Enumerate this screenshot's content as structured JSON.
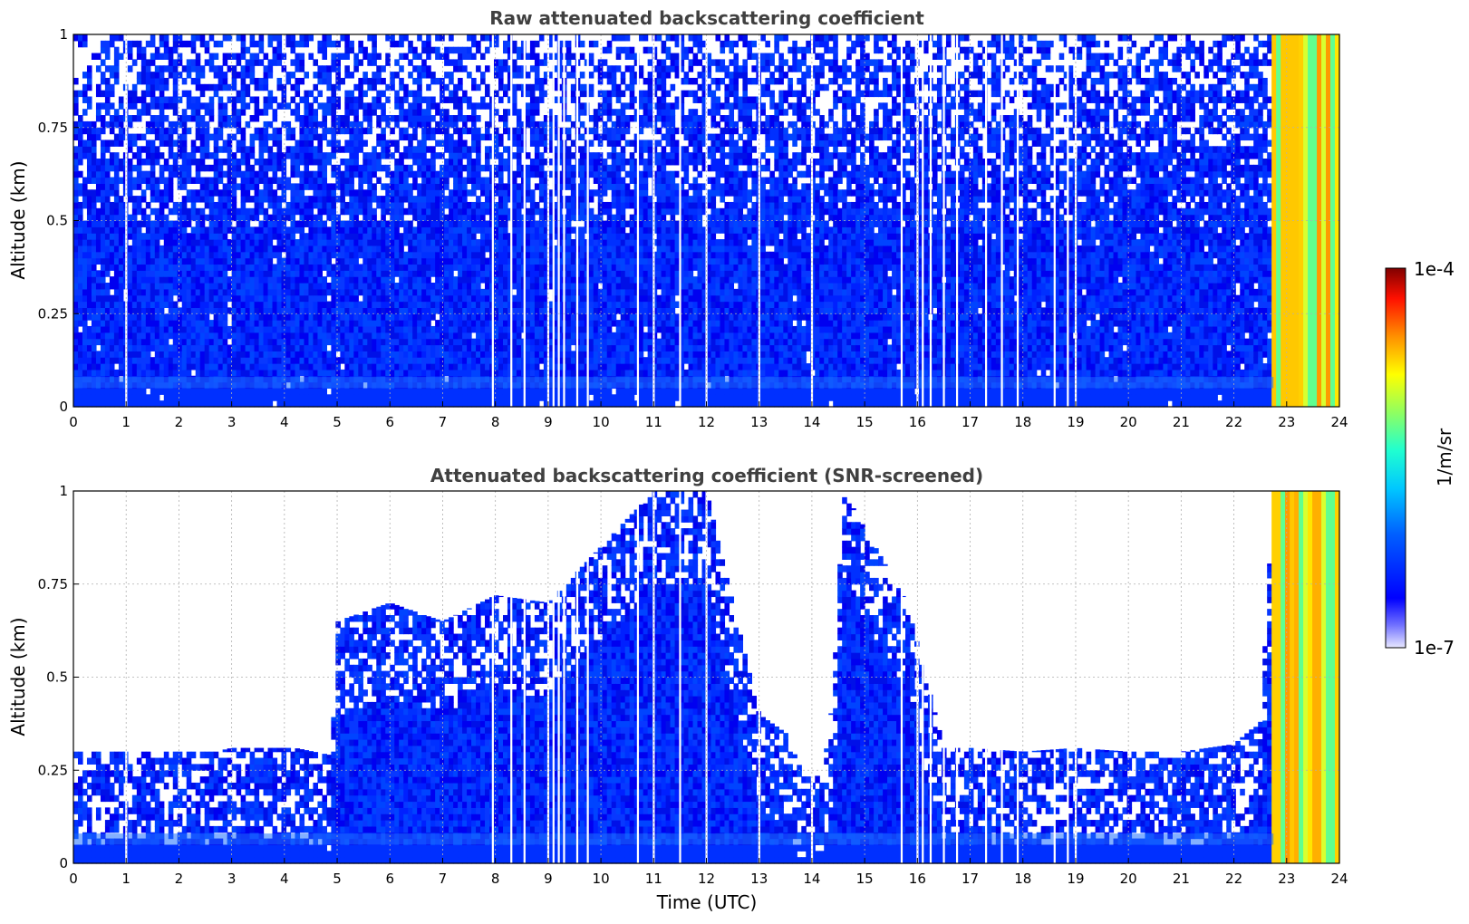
{
  "chart_data": [
    {
      "type": "heatmap",
      "title": "Raw attenuated backscattering coefficient",
      "xlabel": "",
      "ylabel": "Altitude (km)",
      "xlim": [
        0,
        24
      ],
      "ylim": [
        0,
        1
      ],
      "xticks": [
        "0",
        "1",
        "2",
        "3",
        "4",
        "5",
        "6",
        "7",
        "8",
        "9",
        "10",
        "11",
        "12",
        "13",
        "14",
        "15",
        "16",
        "17",
        "18",
        "19",
        "20",
        "21",
        "22",
        "23",
        "24"
      ],
      "yticks": [
        "0",
        "0.25",
        "0.5",
        "0.75",
        "1"
      ],
      "grid": true,
      "colorscale": "jet",
      "color_min": "1e-7",
      "color_max": "1e-4",
      "features": {
        "dense_signal_below_km": 0.45,
        "noisy_sparse_above_km": 0.5,
        "high_backscatter_window_utc": [
          22.75,
          24
        ],
        "gap_columns_utc": [
          1.0,
          7.95,
          8.3,
          8.55,
          9.0,
          9.1,
          9.2,
          9.3,
          9.55,
          9.75,
          10.7,
          11.0,
          11.5,
          12.0,
          13.0,
          14.0,
          15.7,
          16.0,
          16.1,
          16.25,
          16.5,
          16.75,
          17.3,
          17.6,
          17.9,
          18.6,
          18.85,
          19.0
        ]
      }
    },
    {
      "type": "heatmap",
      "title": "Attenuated backscattering coefficient (SNR-screened)",
      "xlabel": "Time (UTC)",
      "ylabel": "Altitude (km)",
      "xlim": [
        0,
        24
      ],
      "ylim": [
        0,
        1
      ],
      "xticks": [
        "0",
        "1",
        "2",
        "3",
        "4",
        "5",
        "6",
        "7",
        "8",
        "9",
        "10",
        "11",
        "12",
        "13",
        "14",
        "15",
        "16",
        "17",
        "18",
        "19",
        "20",
        "21",
        "22",
        "23",
        "24"
      ],
      "yticks": [
        "0",
        "0.25",
        "0.5",
        "0.75",
        "1"
      ],
      "grid": true,
      "colorscale": "jet",
      "color_min": "1e-7",
      "color_max": "1e-4",
      "top_boundary_km": [
        [
          0,
          0.3
        ],
        [
          1.0,
          0.3
        ],
        [
          2.7,
          0.3
        ],
        [
          3.0,
          0.31
        ],
        [
          4.2,
          0.31
        ],
        [
          4.9,
          0.29
        ],
        [
          5.0,
          0.65
        ],
        [
          6.0,
          0.7
        ],
        [
          7.0,
          0.65
        ],
        [
          8.0,
          0.72
        ],
        [
          9.0,
          0.7
        ],
        [
          10.0,
          0.85
        ],
        [
          11.0,
          1.0
        ],
        [
          12.0,
          1.0
        ],
        [
          13.0,
          0.4
        ],
        [
          13.5,
          0.35
        ],
        [
          13.8,
          0.25
        ],
        [
          14.2,
          0.23
        ],
        [
          14.4,
          0.45
        ],
        [
          14.6,
          1.0
        ],
        [
          15.8,
          0.7
        ],
        [
          16.5,
          0.31
        ],
        [
          17.0,
          0.31
        ],
        [
          18.0,
          0.3
        ],
        [
          19.0,
          0.31
        ],
        [
          20.0,
          0.3
        ],
        [
          21.0,
          0.3
        ],
        [
          22.0,
          0.32
        ],
        [
          22.5,
          0.38
        ],
        [
          22.75,
          1.0
        ]
      ],
      "high_backscatter_window_utc": [
        22.75,
        24
      ]
    }
  ],
  "colorbar": {
    "label": "1/m/sr",
    "max_label": "1e-4",
    "min_label": "1e-7"
  }
}
